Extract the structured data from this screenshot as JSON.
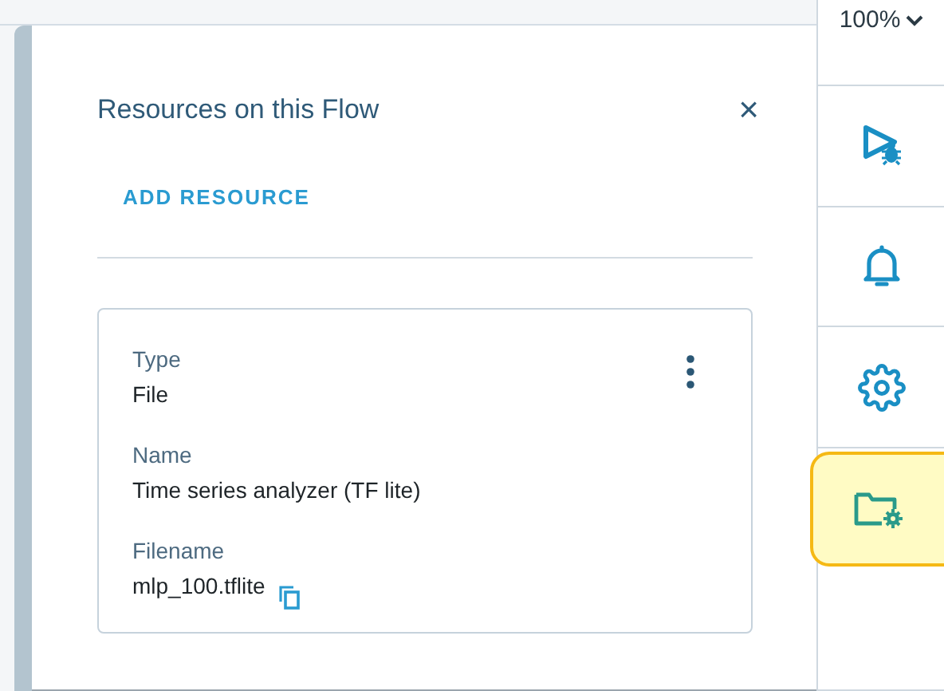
{
  "zoom": {
    "label": "100%"
  },
  "panel": {
    "title": "Resources on this Flow",
    "close": "×",
    "add_button": "ADD RESOURCE"
  },
  "resources": [
    {
      "fields": [
        {
          "label": "Type",
          "value": "File",
          "copy": false
        },
        {
          "label": "Name",
          "value": "Time series analyzer (TF lite)",
          "copy": false
        },
        {
          "label": "Filename",
          "value": "mlp_100.tflite",
          "copy": true
        }
      ]
    }
  ],
  "toolbar": [
    {
      "kind": "debug",
      "selected": false
    },
    {
      "kind": "notifications",
      "selected": false
    },
    {
      "kind": "settings",
      "selected": false
    },
    {
      "kind": "resources",
      "selected": true
    },
    {
      "kind": "blank",
      "selected": false
    }
  ]
}
